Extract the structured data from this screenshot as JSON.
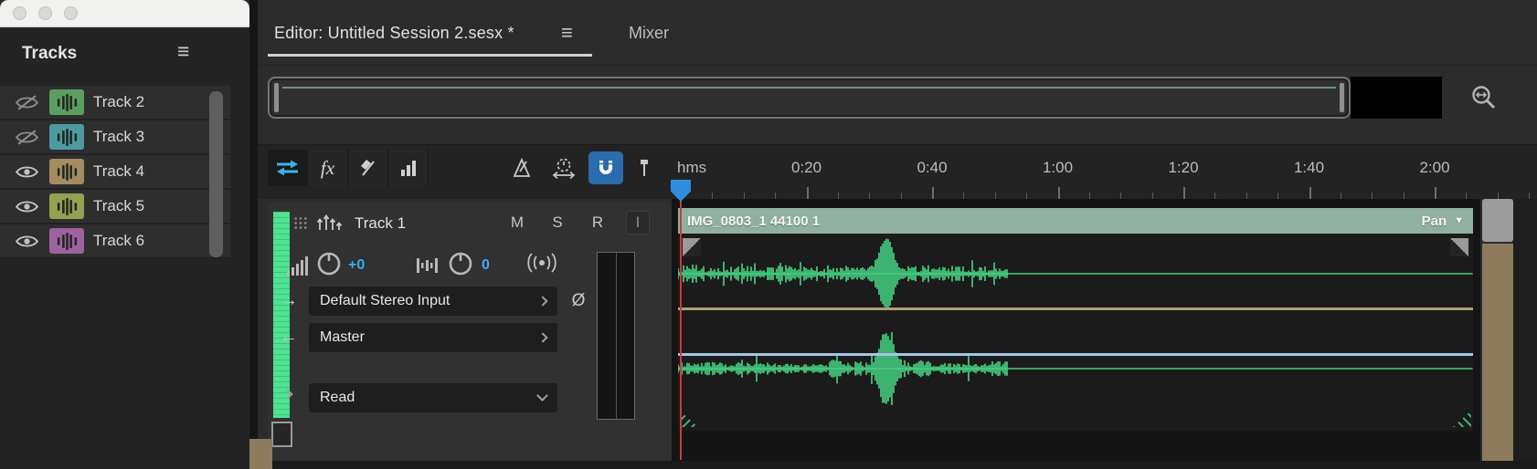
{
  "window": {
    "traffic_lights": [
      "close",
      "minimize",
      "zoom"
    ]
  },
  "tracks_panel": {
    "title": "Tracks",
    "menu_icon": "hamburger-icon",
    "tracks": [
      {
        "name": "Track 2",
        "visible": false,
        "color": "#5c9e5f"
      },
      {
        "name": "Track 3",
        "visible": false,
        "color": "#4f9aa0"
      },
      {
        "name": "Track 4",
        "visible": true,
        "color": "#a38d60"
      },
      {
        "name": "Track 5",
        "visible": true,
        "color": "#95a050"
      },
      {
        "name": "Track 6",
        "visible": true,
        "color": "#9d62a0"
      }
    ]
  },
  "tab_bar": {
    "editor_tab_label": "Editor: Untitled Session 2.sesx *",
    "mixer_tab_label": "Mixer"
  },
  "toolbar": {
    "fx_label": "fx",
    "icons": [
      "move-tool-icon",
      "fx-icon",
      "razor-tool-icon",
      "metering-icon",
      "metronome-icon",
      "skip-playhead-clock-icon",
      "snap-magnet-icon",
      "marker-icon",
      "zoom-navigator-icon"
    ]
  },
  "timeline": {
    "unit_label": "hms",
    "tick_labels": [
      "0:20",
      "0:40",
      "1:00",
      "1:20",
      "1:40",
      "2:00"
    ],
    "seconds_per_major_tick": 20
  },
  "track_header": {
    "name": "Track 1",
    "mute_label": "M",
    "solo_label": "S",
    "record_label": "R",
    "input_monitor_label": "I",
    "volume_value": "+0",
    "pan_value": "0",
    "input_value": "Default Stereo Input",
    "output_value": "Master",
    "automation_mode_value": "Read",
    "phase_label": "Ø"
  },
  "clip": {
    "name": "IMG_0803_1 44100 1",
    "envelope_right_label": "Pan"
  },
  "colors": {
    "accent_blue": "#3fa9f5",
    "waveform_green": "#4be48e",
    "clip_header": "#90b1a1",
    "snap_active_bg": "#2a6cae",
    "meter_green": "#4fe392",
    "volume_envelope": "#b0a175",
    "pan_envelope": "#a5c6e6",
    "playhead_red": "#cf3a3a",
    "playhead_blue": "#2f8fdf"
  }
}
